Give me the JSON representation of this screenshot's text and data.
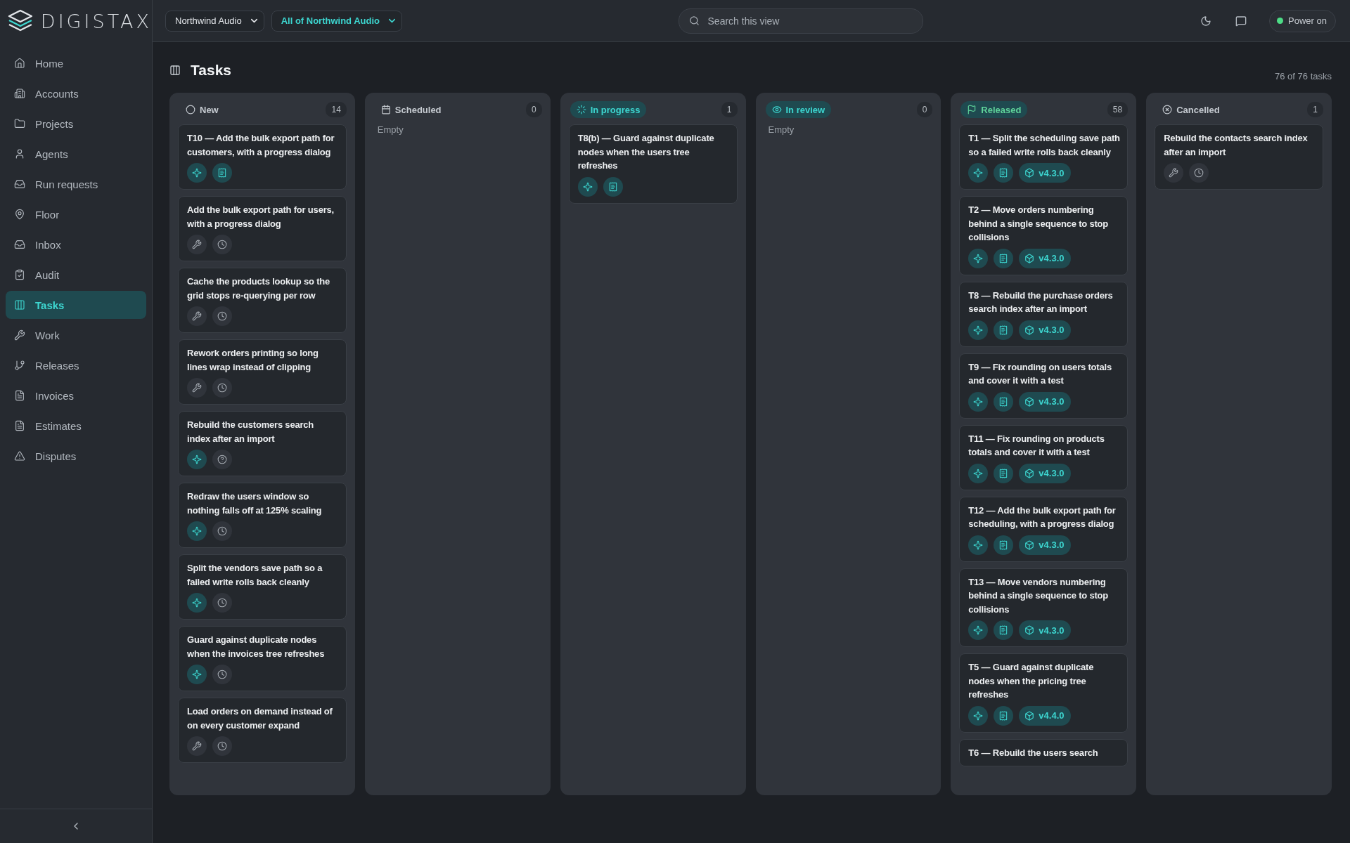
{
  "brand": {
    "name": "DIGISTAX"
  },
  "sidebar": {
    "items": [
      {
        "label": "Home",
        "selected": false
      },
      {
        "label": "Accounts",
        "selected": false
      },
      {
        "label": "Projects",
        "selected": false
      },
      {
        "label": "Agents",
        "selected": false
      },
      {
        "label": "Run requests",
        "selected": false
      },
      {
        "label": "Floor",
        "selected": false
      },
      {
        "label": "Inbox",
        "selected": false
      },
      {
        "label": "Audit",
        "selected": false
      },
      {
        "label": "Tasks",
        "selected": true
      },
      {
        "label": "Work",
        "selected": false
      },
      {
        "label": "Releases",
        "selected": false
      },
      {
        "label": "Invoices",
        "selected": false
      },
      {
        "label": "Estimates",
        "selected": false
      },
      {
        "label": "Disputes",
        "selected": false
      }
    ]
  },
  "topbar": {
    "company_select": "Northwind Audio",
    "scope_select": "All of Northwind Audio",
    "search": {
      "placeholder": "Search this view"
    },
    "power": {
      "label": "Power on",
      "on": true
    }
  },
  "page": {
    "title": "Tasks",
    "count": "76 of 76 tasks"
  },
  "columns": [
    {
      "title": "New",
      "count": "14",
      "kind": "plain",
      "cards": [
        {
          "title": "T10 — Add the bulk export path for customers, with a progress dialog",
          "badges": [
            {
              "kind": "agent"
            },
            {
              "kind": "spec"
            }
          ]
        },
        {
          "title": "Add the bulk export path for users, with a progress dialog",
          "badges": [
            {
              "kind": "manual"
            },
            {
              "kind": "pending"
            }
          ]
        },
        {
          "title": "Cache the products lookup so the grid stops re-querying per row",
          "badges": [
            {
              "kind": "manual"
            },
            {
              "kind": "pending"
            }
          ]
        },
        {
          "title": "Rework orders printing so long lines wrap instead of clipping",
          "badges": [
            {
              "kind": "manual"
            },
            {
              "kind": "pending"
            }
          ]
        },
        {
          "title": "Rebuild the customers search index after an import",
          "badges": [
            {
              "kind": "agent"
            },
            {
              "kind": "question"
            }
          ]
        },
        {
          "title": "Redraw the users window so nothing falls off at 125% scaling",
          "badges": [
            {
              "kind": "agent"
            },
            {
              "kind": "pending"
            }
          ]
        },
        {
          "title": "Split the vendors save path so a failed write rolls back cleanly",
          "badges": [
            {
              "kind": "agent"
            },
            {
              "kind": "pending"
            }
          ]
        },
        {
          "title": "Guard against duplicate nodes when the invoices tree refreshes",
          "badges": [
            {
              "kind": "agent"
            },
            {
              "kind": "pending"
            }
          ]
        },
        {
          "title": "Load orders on demand instead of on every customer expand",
          "badges": [
            {
              "kind": "manual"
            },
            {
              "kind": "pending"
            }
          ]
        }
      ]
    },
    {
      "title": "Scheduled",
      "count": "0",
      "kind": "plain",
      "empty": "Empty"
    },
    {
      "title": "In progress",
      "count": "1",
      "kind": "pill",
      "color": "#3dd6d0",
      "cards": [
        {
          "title": "T8(b) — Guard against duplicate nodes when the users tree refreshes",
          "badges": [
            {
              "kind": "agent"
            },
            {
              "kind": "spec"
            }
          ]
        }
      ]
    },
    {
      "title": "In review",
      "count": "0",
      "kind": "pill",
      "color": "#3dd6d0",
      "empty": "Empty"
    },
    {
      "title": "Released",
      "count": "58",
      "kind": "pill",
      "color": "#5fd39a",
      "cards": [
        {
          "title": "T1 — Split the scheduling save path so a failed write rolls back cleanly",
          "badges": [
            {
              "kind": "agent"
            },
            {
              "kind": "spec"
            }
          ],
          "version": "v4.3.0"
        },
        {
          "title": "T2 — Move orders numbering behind a single sequence to stop collisions",
          "badges": [
            {
              "kind": "agent"
            },
            {
              "kind": "spec"
            }
          ],
          "version": "v4.3.0"
        },
        {
          "title": "T8 — Rebuild the purchase orders search index after an import",
          "badges": [
            {
              "kind": "agent"
            },
            {
              "kind": "spec"
            }
          ],
          "version": "v4.3.0"
        },
        {
          "title": "T9 — Fix rounding on users totals and cover it with a test",
          "badges": [
            {
              "kind": "agent"
            },
            {
              "kind": "spec"
            }
          ],
          "version": "v4.3.0"
        },
        {
          "title": "T11 — Fix rounding on products totals and cover it with a test",
          "badges": [
            {
              "kind": "agent"
            },
            {
              "kind": "spec"
            }
          ],
          "version": "v4.3.0"
        },
        {
          "title": "T12 — Add the bulk export path for scheduling, with a progress dialog",
          "badges": [
            {
              "kind": "agent"
            },
            {
              "kind": "spec"
            }
          ],
          "version": "v4.3.0"
        },
        {
          "title": "T13 — Move vendors numbering behind a single sequence to stop collisions",
          "badges": [
            {
              "kind": "agent"
            },
            {
              "kind": "spec"
            }
          ],
          "version": "v4.3.0"
        },
        {
          "title": "T5 — Guard against duplicate nodes when the pricing tree refreshes",
          "badges": [
            {
              "kind": "agent"
            },
            {
              "kind": "spec"
            }
          ],
          "version": "v4.4.0"
        },
        {
          "title": "T6 — Rebuild the users search"
        }
      ]
    },
    {
      "title": "Cancelled",
      "count": "1",
      "kind": "plain",
      "cards": [
        {
          "title": "Rebuild the contacts search index after an import",
          "badges": [
            {
              "kind": "manual"
            },
            {
              "kind": "pending"
            }
          ]
        }
      ]
    }
  ]
}
